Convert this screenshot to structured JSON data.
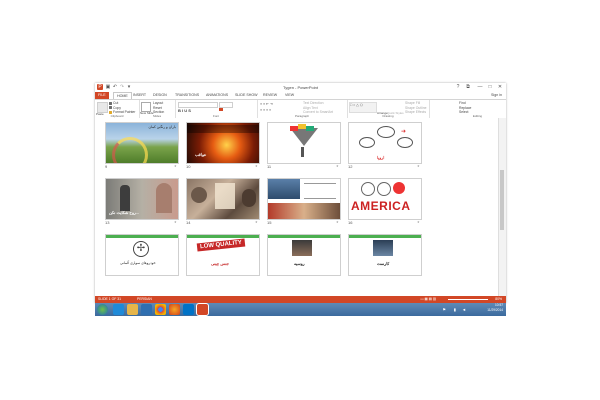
{
  "window": {
    "title": "Tygen - PowerPoint",
    "controls": [
      "?",
      "⧉",
      "—",
      "□",
      "✕"
    ]
  },
  "quick_access": [
    {
      "icon": "powerpoint-icon",
      "glyph": "P"
    },
    {
      "icon": "save-icon",
      "glyph": "▣"
    },
    {
      "icon": "undo-icon",
      "glyph": "↶"
    },
    {
      "icon": "redo-icon",
      "glyph": "↷"
    },
    {
      "icon": "customize-icon",
      "glyph": "▾"
    }
  ],
  "tabs": [
    "FILE",
    "HOME",
    "INSERT",
    "DESIGN",
    "TRANSITIONS",
    "ANIMATIONS",
    "SLIDE SHOW",
    "REVIEW",
    "VIEW"
  ],
  "active_tab": "HOME",
  "sign_in": "Sign in",
  "ribbon": {
    "clipboard": {
      "label": "Clipboard",
      "paste": "Paste",
      "cut": "Cut",
      "copy": "Copy",
      "format_painter": "Format Painter"
    },
    "slides": {
      "label": "Slides",
      "new_slide": "New Slide",
      "layout": "Layout",
      "reset": "Reset",
      "section": "Section"
    },
    "font": {
      "label": "Font"
    },
    "paragraph": {
      "label": "Paragraph",
      "text_direction": "Text Direction",
      "align_text": "Align Text",
      "convert": "Convert to SmartArt"
    },
    "drawing": {
      "label": "Drawing",
      "arrange": "Arrange",
      "quick_styles": "Quick Styles",
      "shape_fill": "Shape Fill",
      "shape_outline": "Shape Outline",
      "shape_effects": "Shape Effects"
    },
    "editing": {
      "label": "Editing",
      "find": "Find",
      "replace": "Replace",
      "select": "Select"
    }
  },
  "slides": [
    {
      "num": "9",
      "theme": "rainbow",
      "caption": "باران و رنگین کمان"
    },
    {
      "num": "10",
      "theme": "explosion",
      "caption": "عواقب"
    },
    {
      "num": "11",
      "theme": "funnel",
      "caption": ""
    },
    {
      "num": "12",
      "theme": "mindmap",
      "caption": "اروپا"
    },
    {
      "num": "13",
      "theme": "sad",
      "caption": "روح شکایت نکن..."
    },
    {
      "num": "14",
      "theme": "crowd",
      "caption": ""
    },
    {
      "num": "15",
      "theme": "news",
      "caption": ""
    },
    {
      "num": "16",
      "theme": "america",
      "caption": "AMERICA"
    },
    {
      "num": "17",
      "theme": "mercedes",
      "caption": "خودروهای سواری آلمانی"
    },
    {
      "num": "18",
      "theme": "lowquality",
      "caption": "جنس چینی",
      "stamp": "LOW QUALITY"
    },
    {
      "num": "19",
      "theme": "person",
      "caption": "روسیه"
    },
    {
      "num": "20",
      "theme": "laptop",
      "caption": "کارست"
    }
  ],
  "status": {
    "slide": "SLIDE 1 OF 31",
    "language": "PERSIAN",
    "zoom": "80%"
  },
  "taskbar": {
    "apps": [
      "ie-icon",
      "explorer-icon",
      "media-player-icon",
      "chrome-icon",
      "firefox-icon",
      "outlook-icon",
      "powerpoint-icon"
    ],
    "time": "10:57",
    "date": "11/29/2014"
  },
  "colors": {
    "accent": "#d24726",
    "taskbar": "#3b6a9e"
  }
}
